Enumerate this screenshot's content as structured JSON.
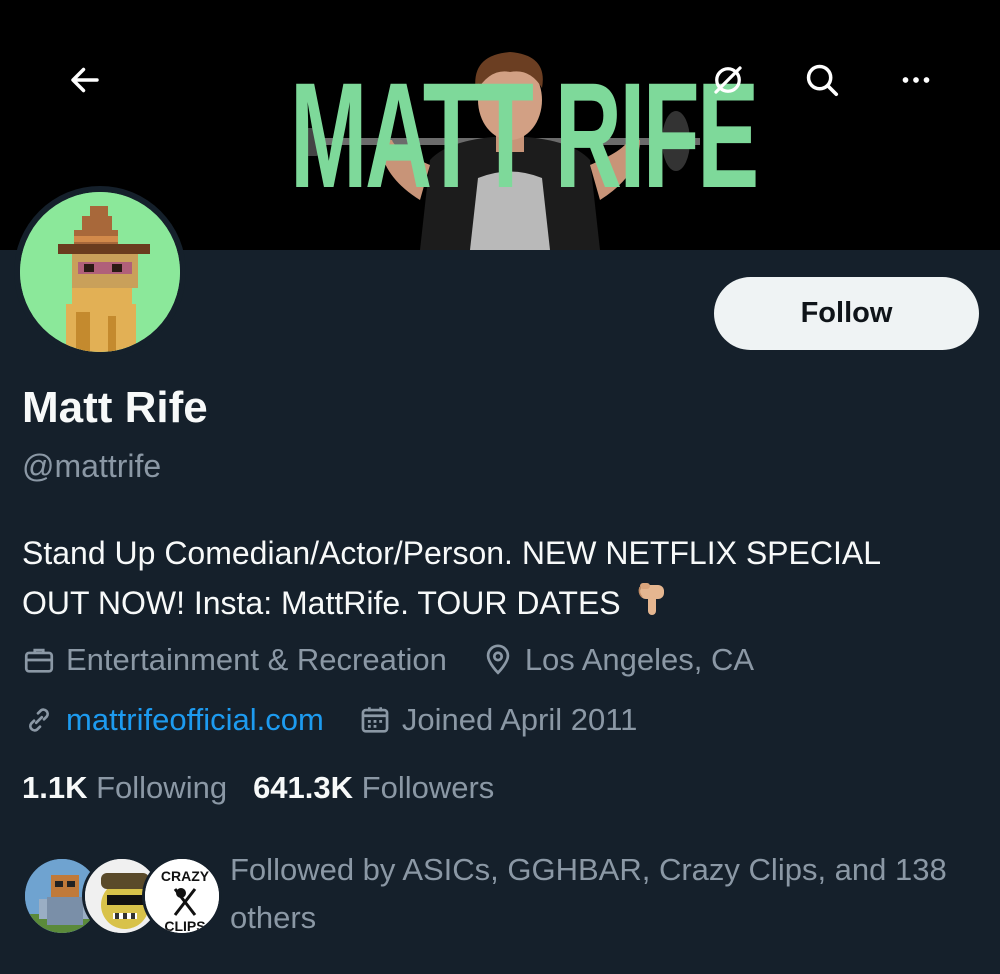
{
  "banner": {
    "title": "MATT RIFE",
    "colors": {
      "title_green": "#7ed99a",
      "background": "#000000"
    }
  },
  "nav": {
    "back_icon": "arrow-left-icon",
    "no_notify_icon": "slashed-circle-icon",
    "search_icon": "search-icon",
    "more_icon": "more-horizontal-icon"
  },
  "profile": {
    "name": "Matt Rife",
    "handle": "@mattrife",
    "follow_label": "Follow",
    "bio": "Stand Up Comedian/Actor/Person. NEW NETFLIX SPECIAL OUT NOW! Insta: MattRife. TOUR DATES",
    "bio_emoji": "pointing-down-hand-icon",
    "category": "Entertainment & Recreation",
    "location": "Los Angeles, CA",
    "website": "mattrifeofficial.com",
    "joined": "Joined April 2011"
  },
  "stats": {
    "following_count": "1.1K",
    "following_label": "Following",
    "followers_count": "641.3K",
    "followers_label": "Followers"
  },
  "followed_by": {
    "text": "Followed by ASICs, GGHBAR, Crazy Clips, and 138 others",
    "avatars": [
      "ASICs",
      "GGHBAR",
      "Crazy Clips"
    ],
    "crazy_clips_top": "CRAZY",
    "crazy_clips_bottom": "CLIPS"
  },
  "theme": {
    "background": "#15202b",
    "text_primary": "#f7f9f9",
    "text_secondary": "#8b98a5",
    "link": "#1d9bf0",
    "button_bg": "#eff3f4"
  }
}
